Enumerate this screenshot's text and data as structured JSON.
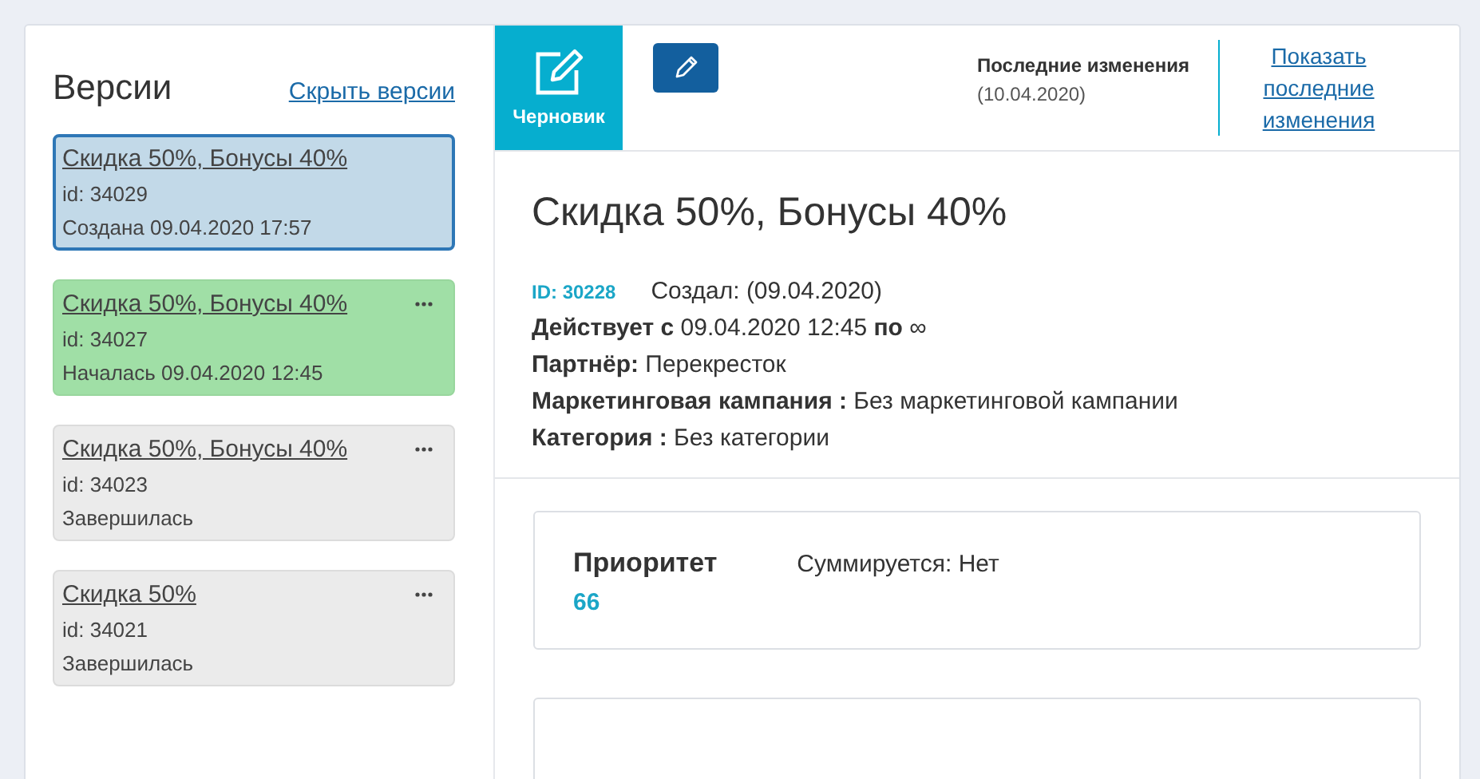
{
  "versions_panel": {
    "title": "Версии",
    "hide_link": "Скрыть версии",
    "items": [
      {
        "name": "Скидка 50%, Бонусы 40%",
        "id": "id: 34029",
        "status_text": "Создана 09.04.2020 17:57",
        "kind": "draft",
        "selected": true,
        "menu": false
      },
      {
        "name": "Скидка 50%, Бонусы 40%",
        "id": "id: 34027",
        "status_text": "Началась 09.04.2020 12:45",
        "kind": "active",
        "selected": false,
        "menu": true
      },
      {
        "name": "Скидка 50%, Бонусы 40%",
        "id": "id: 34023",
        "status_text": "Завершилась",
        "kind": "ended",
        "selected": false,
        "menu": true
      },
      {
        "name": "Скидка 50%",
        "id": "id: 34021",
        "status_text": "Завершилась",
        "kind": "ended",
        "selected": false,
        "menu": true
      }
    ]
  },
  "toolbar": {
    "draft_tab": "Черновик",
    "last_changes_label": "Последние изменения",
    "last_changes_date": "(10.04.2020)",
    "show_changes_link": "Показать последние изменения"
  },
  "details": {
    "title": "Скидка 50%, Бонусы 40%",
    "id": "ID: 30228",
    "created": "Создал: (09.04.2020)",
    "lines": [
      "**Действует с** 09.04.2020 12:45 **по** ∞",
      "**Партнёр:** Перекресток",
      "**Маркетинговая кампания :** Без маркетинговой кампании",
      "**Категория :** Без категории"
    ]
  },
  "priority_card": {
    "label": "Приоритет",
    "value": "66",
    "summation": "Суммируется: Нет"
  }
}
